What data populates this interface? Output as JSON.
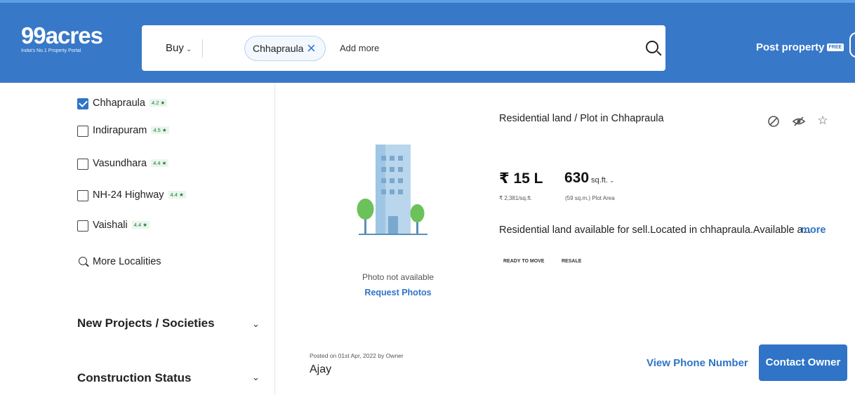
{
  "header": {
    "logo": "99acres",
    "tagline": "India's No.1 Property Portal",
    "buy_label": "Buy",
    "chip_label": "Chhapraula",
    "add_more": "Add more",
    "post_property": "Post property",
    "free_badge": "FREE",
    "accent_color": "#3878c8"
  },
  "sidebar": {
    "localities": [
      {
        "name": "Chhapraula",
        "rating": "4.2",
        "checked": true
      },
      {
        "name": "Indirapuram",
        "rating": "4.5",
        "checked": false
      },
      {
        "name": "Vasundhara",
        "rating": "4.4",
        "checked": false
      },
      {
        "name": "NH-24 Highway",
        "rating": "4.4",
        "checked": false
      },
      {
        "name": "Vaishali",
        "rating": "4.4",
        "checked": false
      }
    ],
    "more_localities": "More Localities",
    "filters": [
      {
        "label": "New Projects / Societies"
      },
      {
        "label": "Construction Status"
      }
    ]
  },
  "listing": {
    "title": "Residential land / Plot in Chhapraula",
    "price": "₹ 15 L",
    "price_per_sqft": "₹ 2,381/sq.ft.",
    "area_value": "630",
    "area_unit": "sq.ft.",
    "area_sub": "(59 sq.m.) Plot Area",
    "description": "Residential land available for sell.Located in chhapraula.Available a...",
    "more": "more",
    "tags": [
      "READY TO MOVE",
      "RESALE"
    ],
    "photo_not_available": "Photo not available",
    "request_photos": "Request Photos",
    "posted": "Posted on 01st Apr, 2022 by Owner",
    "owner_name": "Ajay",
    "view_phone": "View Phone Number",
    "contact_owner": "Contact Owner",
    "icons": [
      "hide-icon",
      "not-interested-icon",
      "shortlist-star-icon"
    ]
  }
}
